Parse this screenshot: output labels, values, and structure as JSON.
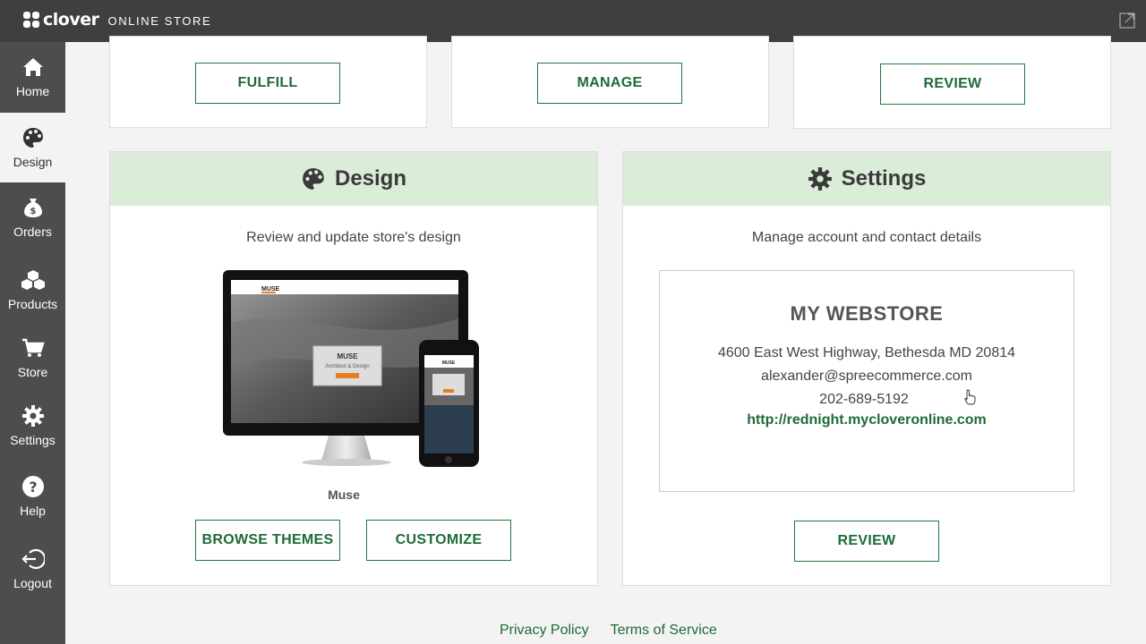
{
  "header": {
    "brand": "clover",
    "product": "ONLINE STORE",
    "external_icon": "external-link-icon"
  },
  "sidebar": {
    "items": [
      {
        "label": "Home",
        "icon": "home-icon",
        "active": false
      },
      {
        "label": "Design",
        "icon": "palette-icon",
        "active": true
      },
      {
        "label": "Orders",
        "icon": "money-bag-icon",
        "active": false
      },
      {
        "label": "Products",
        "icon": "boxes-icon",
        "active": false
      },
      {
        "label": "Store",
        "icon": "cart-icon",
        "active": false
      },
      {
        "label": "Settings",
        "icon": "gear-icon",
        "active": false
      },
      {
        "label": "Help",
        "icon": "help-icon",
        "active": false
      },
      {
        "label": "Logout",
        "icon": "logout-icon",
        "active": false
      }
    ]
  },
  "top_cards": [
    {
      "button": "FULFILL"
    },
    {
      "button": "MANAGE"
    },
    {
      "button": "REVIEW"
    }
  ],
  "design": {
    "title": "Design",
    "description": "Review and update store's design",
    "theme_name": "Muse",
    "preview": {
      "brand": "MUSE",
      "tagline": "Architect & Design"
    },
    "browse_button": "BROWSE THEMES",
    "customize_button": "CUSTOMIZE"
  },
  "settings": {
    "title": "Settings",
    "description": "Manage account and contact details",
    "store_name": "MY WEBSTORE",
    "address": "4600 East West Highway, Bethesda MD 20814",
    "email": "alexander@spreecommerce.com",
    "phone": "202-689-5192",
    "url": "http://rednight.mycloveronline.com",
    "review_button": "REVIEW"
  },
  "footer": {
    "privacy": "Privacy Policy",
    "terms": "Terms of Service"
  },
  "colors": {
    "topbar": "#3f3f3f",
    "sidebar": "#4d4d4d",
    "accent": "#1e6b38",
    "card_header": "#dbedd9"
  }
}
